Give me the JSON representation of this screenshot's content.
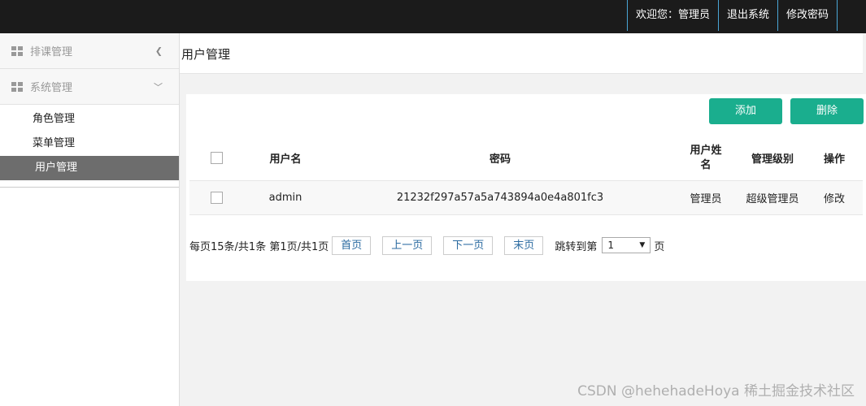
{
  "topbar": {
    "welcome": "欢迎您：管理员",
    "logout": "退出系统",
    "change_password": "修改密码"
  },
  "sidebar": {
    "groups": [
      {
        "label": "排课管理",
        "expanded": false
      },
      {
        "label": "系统管理",
        "expanded": true
      }
    ],
    "sub_items": [
      "角色管理",
      "菜单管理",
      "用户管理"
    ],
    "active_item": "用户管理"
  },
  "page": {
    "title": "用户管理"
  },
  "toolbar": {
    "add_label": "添加",
    "delete_label": "删除"
  },
  "table": {
    "headers": {
      "username": "用户名",
      "password": "密码",
      "realname_line1": "用户姓",
      "realname_line2": "名",
      "level": "管理级别",
      "action": "操作"
    },
    "rows": [
      {
        "username": "admin",
        "password": "21232f297a57a5a743894a0e4a801fc3",
        "realname": "管理员",
        "level": "超级管理员",
        "action": "修改"
      }
    ]
  },
  "pager": {
    "info": "每页15条/共1条 第1页/共1页",
    "first": "首页",
    "prev": "上一页",
    "next": "下一页",
    "last": "末页",
    "jump_label": "跳转到第",
    "page_value": "1",
    "page_suffix": "页"
  },
  "watermark": "CSDN @hehehadeHoya 稀土掘金技术社区",
  "colors": {
    "topbar": "#1b1b1b",
    "accent": "#1aae8e",
    "active_menu": "#6d6d6d"
  }
}
